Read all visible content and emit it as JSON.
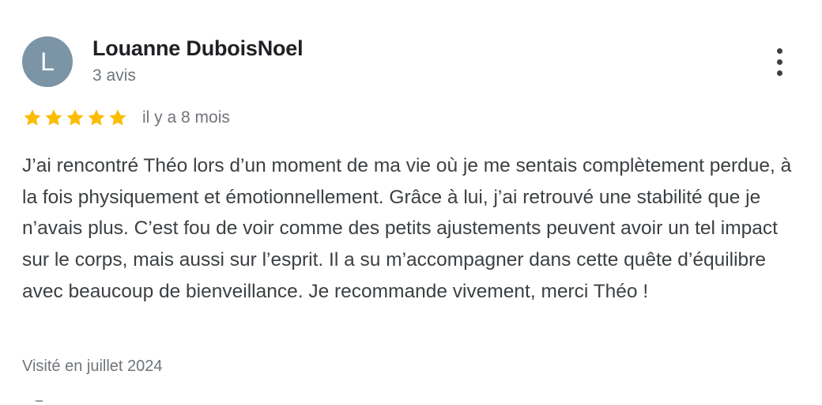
{
  "review": {
    "author": {
      "initial": "L",
      "name": "Louanne DuboisNoel",
      "review_count": "3 avis",
      "avatar_color": "#7b95a6"
    },
    "menu_icon": "more-vert-icon",
    "rating": {
      "stars": 5,
      "max": 5,
      "star_color": "#fbbc04",
      "icon": "star-icon"
    },
    "time_ago": "il y a 8 mois",
    "text": "J’ai rencontré Théo lors d’un moment de ma vie où je me sentais complètement perdue, à la fois physiquement et émotionnellement. Grâce à lui, j’ai retrouvé une stabilité que je n’avais plus. C’est fou de voir comme des petits ajustements peuvent avoir un tel impact sur le corps, mais aussi sur l’esprit. Il a su m’accompagner dans cette quête d’équilibre avec beaucoup de bienveillance. Je recommande vivement, merci Théo !",
    "visited": "Visité en juillet 2024"
  }
}
